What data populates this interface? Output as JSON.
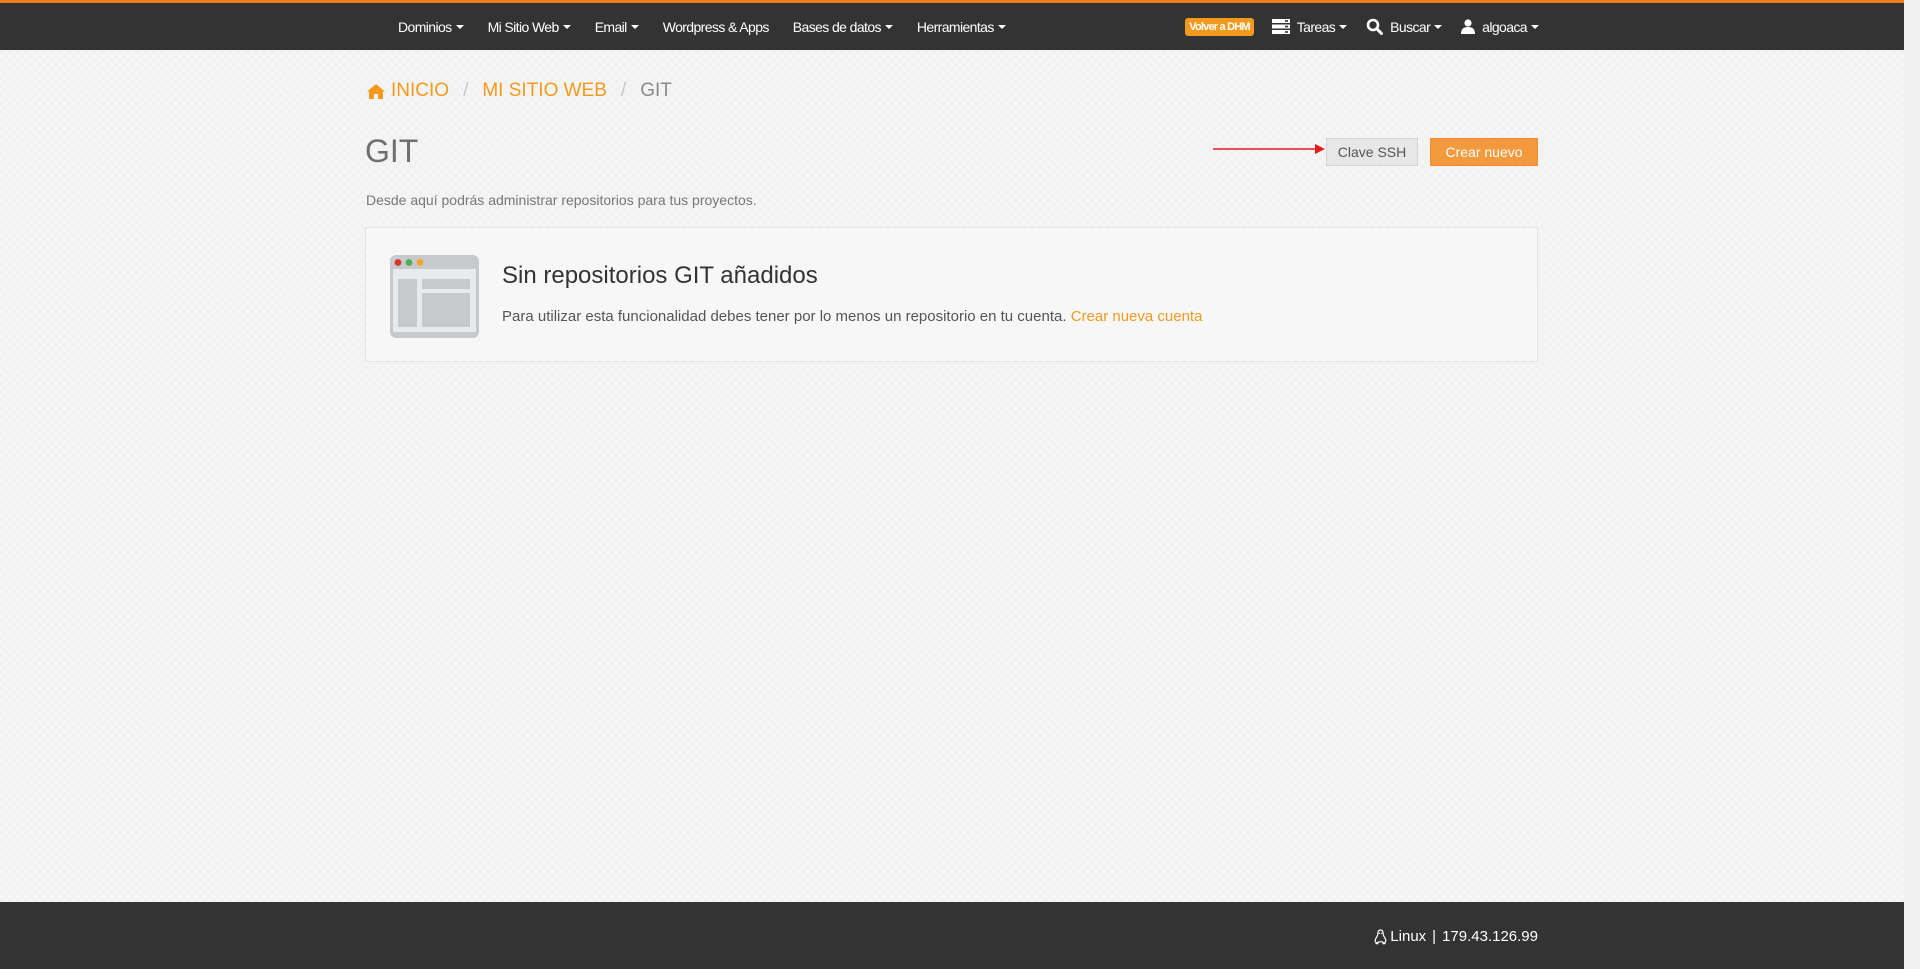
{
  "nav": {
    "items": [
      {
        "label": "Dominios",
        "has_caret": true
      },
      {
        "label": "Mi Sitio Web",
        "has_caret": true
      },
      {
        "label": "Email",
        "has_caret": true
      },
      {
        "label": "Wordpress & Apps",
        "has_caret": false
      },
      {
        "label": "Bases de datos",
        "has_caret": true
      },
      {
        "label": "Herramientas",
        "has_caret": true
      }
    ],
    "volver_label": "Volver a DHM",
    "tasks_label": "Tareas",
    "search_label": "Buscar",
    "user_label": "algoaca"
  },
  "breadcrumb": {
    "home": "INICIO",
    "section": "MI SITIO WEB",
    "current": "GIT"
  },
  "page": {
    "title": "GIT",
    "description": "Desde aquí podrás administrar repositorios para tus proyectos."
  },
  "actions": {
    "ssh_label": "Clave SSH",
    "create_label": "Crear nuevo"
  },
  "empty_state": {
    "title": "Sin repositorios GIT añadidos",
    "text": "Para utilizar esta funcionalidad debes tener por lo menos un repositorio en tu cuenta.",
    "link": "Crear nueva cuenta"
  },
  "footer": {
    "os": "Linux",
    "ip": "179.43.126.99"
  },
  "colors": {
    "accent": "#f39a1d",
    "navbar": "#333333",
    "annotation_arrow": "#e31b1b"
  },
  "icons": [
    "home-icon",
    "tasks-icon",
    "search-icon",
    "user-icon",
    "browser-window-icon",
    "linux-icon",
    "arrow-annotation"
  ]
}
